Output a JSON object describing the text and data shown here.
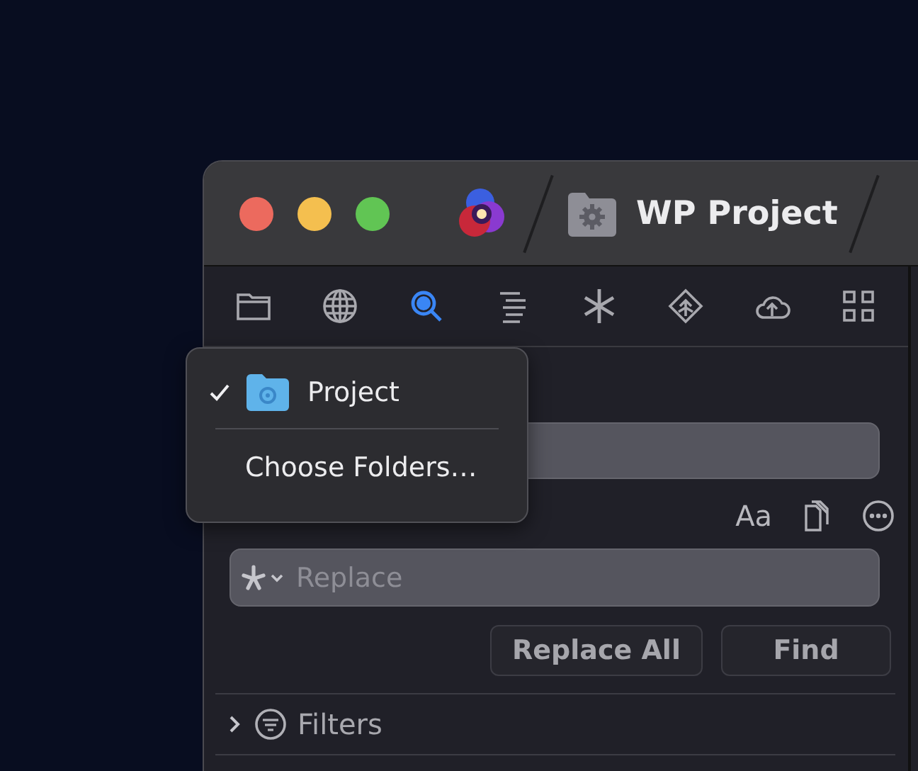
{
  "window": {
    "title": "WP Project"
  },
  "toolbar": [
    {
      "kind": "folder",
      "selected": false
    },
    {
      "kind": "globe",
      "selected": false
    },
    {
      "kind": "search",
      "selected": true
    },
    {
      "kind": "outline",
      "selected": false
    },
    {
      "kind": "asterisk",
      "selected": false
    },
    {
      "kind": "diamond",
      "selected": false
    },
    {
      "kind": "cloud",
      "selected": false
    },
    {
      "kind": "grid",
      "selected": false
    }
  ],
  "options": {
    "case_label": "Aa"
  },
  "replace": {
    "placeholder": "Replace"
  },
  "buttons": [
    "Replace All",
    "Find"
  ],
  "filters": {
    "label": "Filters",
    "expanded": false
  },
  "scope_menu": [
    {
      "label": "Project",
      "checked": true,
      "kind": "folder"
    },
    {
      "kind": "separator"
    },
    {
      "label": "Choose Folders…",
      "checked": false,
      "kind": "item"
    }
  ]
}
